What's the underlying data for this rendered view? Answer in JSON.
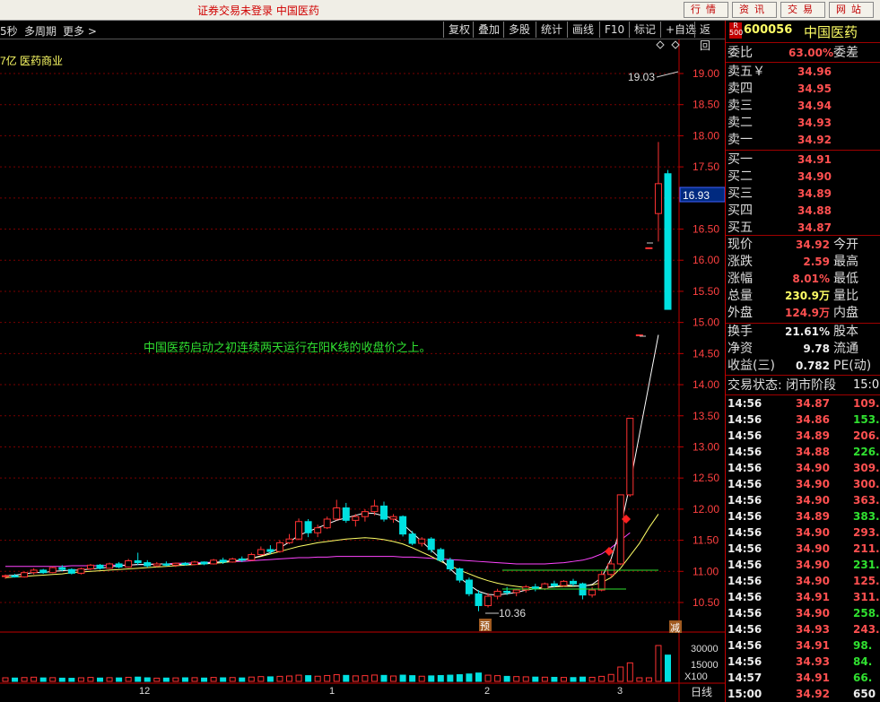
{
  "window": {
    "title": "证券交易未登录  中国医药",
    "top_buttons": [
      "行情",
      "资讯",
      "交易",
      "网站"
    ]
  },
  "toolbar": {
    "left_items": [
      "5秒",
      "多周期",
      "更多 >"
    ],
    "buttons": [
      "复权",
      "叠加",
      "多股",
      "统计",
      "画线",
      "F10",
      "标记",
      "+自选",
      "返回"
    ]
  },
  "chart_header": {
    "info": "7亿  医药商业"
  },
  "annotation": "中国医药启动之初连续两天运行在阳K线的收盘价之上。",
  "markers": {
    "high": "19.03",
    "low": "10.36",
    "yu": "预",
    "jian": "减"
  },
  "current_price_tag": "16.93",
  "volume_labels": {
    "v1": "30000",
    "v2": "15000",
    "scale": "X100"
  },
  "period_label": "日线",
  "x_month_labels": [
    "12",
    "1",
    "2",
    "3"
  ],
  "colors": {
    "up": "#ff3232",
    "down": "#00e0e0",
    "ma5": "#ffffff",
    "ma10": "#ffff66",
    "ma20": "#ff44ff",
    "grid": "#7a0000"
  },
  "chart_data": {
    "type": "candlestick",
    "ylim": [
      10.1,
      19.4
    ],
    "y_ticks": [
      "19.00",
      "18.50",
      "18.00",
      "17.50",
      "17.00",
      "16.50",
      "16.00",
      "15.50",
      "15.00",
      "14.50",
      "14.00",
      "13.50",
      "13.00",
      "12.50",
      "12.00",
      "11.50",
      "11.00",
      "10.50"
    ],
    "candles": [
      [
        10.92,
        10.95,
        10.88,
        10.93
      ],
      [
        10.93,
        10.96,
        10.9,
        10.91
      ],
      [
        10.91,
        11.0,
        10.9,
        10.98
      ],
      [
        10.98,
        11.05,
        10.95,
        11.02
      ],
      [
        11.02,
        11.04,
        10.96,
        10.98
      ],
      [
        10.98,
        11.08,
        10.97,
        11.06
      ],
      [
        11.06,
        11.1,
        11.0,
        11.03
      ],
      [
        11.03,
        11.05,
        10.95,
        10.97
      ],
      [
        10.97,
        11.06,
        10.95,
        11.04
      ],
      [
        11.04,
        11.12,
        11.02,
        11.1
      ],
      [
        11.1,
        11.12,
        11.03,
        11.05
      ],
      [
        11.05,
        11.14,
        11.04,
        11.12
      ],
      [
        11.12,
        11.15,
        11.05,
        11.07
      ],
      [
        11.07,
        11.2,
        11.06,
        11.17
      ],
      [
        11.17,
        11.3,
        11.1,
        11.14
      ],
      [
        11.14,
        11.18,
        11.06,
        11.09
      ],
      [
        11.09,
        11.15,
        11.07,
        11.12
      ],
      [
        11.12,
        11.16,
        11.08,
        11.1
      ],
      [
        11.1,
        11.14,
        11.07,
        11.13
      ],
      [
        11.13,
        11.15,
        11.09,
        11.11
      ],
      [
        11.11,
        11.17,
        11.1,
        11.15
      ],
      [
        11.15,
        11.16,
        11.1,
        11.12
      ],
      [
        11.12,
        11.2,
        11.11,
        11.18
      ],
      [
        11.18,
        11.22,
        11.12,
        11.15
      ],
      [
        11.15,
        11.22,
        11.14,
        11.2
      ],
      [
        11.2,
        11.24,
        11.15,
        11.18
      ],
      [
        11.18,
        11.3,
        11.17,
        11.27
      ],
      [
        11.27,
        11.4,
        11.25,
        11.35
      ],
      [
        11.35,
        11.42,
        11.28,
        11.32
      ],
      [
        11.32,
        11.5,
        11.3,
        11.46
      ],
      [
        11.46,
        11.6,
        11.44,
        11.52
      ],
      [
        11.52,
        11.85,
        11.5,
        11.8
      ],
      [
        11.8,
        11.84,
        11.55,
        11.62
      ],
      [
        11.62,
        11.75,
        11.55,
        11.7
      ],
      [
        11.7,
        11.88,
        11.68,
        11.84
      ],
      [
        11.84,
        12.15,
        11.82,
        12.02
      ],
      [
        12.02,
        12.1,
        11.78,
        11.82
      ],
      [
        11.82,
        11.92,
        11.72,
        11.88
      ],
      [
        11.88,
        12.0,
        11.8,
        11.96
      ],
      [
        11.96,
        12.15,
        11.9,
        12.05
      ],
      [
        12.05,
        12.12,
        11.8,
        11.84
      ],
      [
        11.84,
        11.92,
        11.78,
        11.88
      ],
      [
        11.88,
        11.9,
        11.56,
        11.6
      ],
      [
        11.6,
        11.65,
        11.42,
        11.45
      ],
      [
        11.45,
        11.55,
        11.4,
        11.52
      ],
      [
        11.52,
        11.55,
        11.3,
        11.35
      ],
      [
        11.35,
        11.38,
        11.15,
        11.18
      ],
      [
        11.18,
        11.22,
        11.0,
        11.04
      ],
      [
        11.04,
        11.06,
        10.82,
        10.86
      ],
      [
        10.86,
        10.9,
        10.6,
        10.64
      ],
      [
        10.64,
        10.7,
        10.36,
        10.45
      ],
      [
        10.45,
        10.65,
        10.42,
        10.6
      ],
      [
        10.6,
        10.72,
        10.55,
        10.68
      ],
      [
        10.68,
        10.75,
        10.62,
        10.66
      ],
      [
        10.66,
        10.72,
        10.6,
        10.7
      ],
      [
        10.7,
        10.78,
        10.66,
        10.75
      ],
      [
        10.75,
        10.8,
        10.68,
        10.72
      ],
      [
        10.72,
        10.82,
        10.7,
        10.8
      ],
      [
        10.8,
        10.85,
        10.74,
        10.77
      ],
      [
        10.77,
        10.86,
        10.75,
        10.84
      ],
      [
        10.84,
        10.88,
        10.76,
        10.8
      ],
      [
        10.8,
        10.82,
        10.55,
        10.62
      ],
      [
        10.62,
        10.75,
        10.58,
        10.7
      ],
      [
        10.7,
        11.0,
        10.68,
        10.95
      ],
      [
        10.95,
        11.2,
        10.9,
        11.12
      ],
      [
        11.12,
        12.23,
        11.1,
        12.23
      ],
      [
        12.23,
        13.46,
        12.2,
        13.46
      ],
      [
        14.8,
        14.8,
        14.8,
        14.8
      ],
      [
        16.2,
        16.2,
        16.2,
        16.2
      ],
      [
        16.75,
        17.9,
        16.3,
        17.23
      ],
      [
        17.39,
        17.45,
        15.21,
        15.21
      ]
    ],
    "ma5": [
      10.93,
      10.94,
      10.96,
      10.98,
      10.98,
      11.0,
      11.01,
      11.02,
      11.02,
      11.04,
      11.05,
      11.07,
      11.09,
      11.1,
      11.11,
      11.11,
      11.12,
      11.12,
      11.11,
      11.11,
      11.12,
      11.13,
      11.14,
      11.16,
      11.17,
      11.18,
      11.21,
      11.25,
      11.3,
      11.38,
      11.47,
      11.58,
      11.64,
      11.7,
      11.76,
      11.82,
      11.86,
      11.9,
      11.94,
      11.93,
      11.89,
      11.85,
      11.76,
      11.62,
      11.48,
      11.34,
      11.2,
      11.04,
      10.9,
      10.78,
      10.68,
      10.63,
      10.62,
      10.64,
      10.66,
      10.7,
      10.72,
      10.74,
      10.76,
      10.78,
      10.77,
      10.76,
      10.79,
      10.9,
      11.2,
      11.7,
      12.4,
      13.2,
      14.0,
      14.8
    ],
    "ma10": [
      10.9,
      10.91,
      10.92,
      10.93,
      10.94,
      10.95,
      10.96,
      10.98,
      10.99,
      11.0,
      11.01,
      11.02,
      11.03,
      11.04,
      11.05,
      11.06,
      11.07,
      11.08,
      11.09,
      11.1,
      11.11,
      11.12,
      11.13,
      11.14,
      11.16,
      11.18,
      11.21,
      11.24,
      11.28,
      11.32,
      11.36,
      11.4,
      11.43,
      11.46,
      11.48,
      11.5,
      11.52,
      11.53,
      11.54,
      11.53,
      11.51,
      11.48,
      11.44,
      11.38,
      11.31,
      11.24,
      11.16,
      11.09,
      11.02,
      10.96,
      10.9,
      10.85,
      10.81,
      10.78,
      10.76,
      10.74,
      10.74,
      10.74,
      10.75,
      10.76,
      10.76,
      10.77,
      10.78,
      10.82,
      10.9,
      11.05,
      11.25,
      11.45,
      11.7,
      11.92
    ],
    "ma20": [
      11.08,
      11.08,
      11.08,
      11.08,
      11.08,
      11.08,
      11.08,
      11.09,
      11.09,
      11.09,
      11.09,
      11.1,
      11.1,
      11.1,
      11.11,
      11.11,
      11.12,
      11.12,
      11.13,
      11.13,
      11.14,
      11.14,
      11.15,
      11.15,
      11.16,
      11.16,
      11.17,
      11.18,
      11.19,
      11.2,
      11.21,
      11.22,
      11.22,
      11.23,
      11.23,
      11.24,
      11.24,
      11.24,
      11.24,
      11.24,
      11.24,
      11.24,
      11.23,
      11.23,
      11.22,
      11.21,
      11.2,
      11.19,
      11.18,
      11.17,
      11.16,
      11.15,
      11.14,
      11.13,
      11.12,
      11.12,
      11.12,
      11.12,
      11.13,
      11.14,
      11.16,
      11.18,
      11.22,
      11.28,
      11.38,
      11.5,
      11.62
    ],
    "volume": [
      3000,
      2800,
      3200,
      3500,
      2900,
      3100,
      2700,
      2600,
      3000,
      3300,
      2800,
      3100,
      2900,
      3400,
      3600,
      3000,
      2700,
      2800,
      2900,
      3000,
      3100,
      2800,
      3300,
      3000,
      3200,
      2900,
      3600,
      4000,
      3800,
      4200,
      4500,
      5200,
      4800,
      4300,
      4900,
      5600,
      5000,
      4600,
      4800,
      5300,
      5000,
      4500,
      5200,
      4800,
      4300,
      4600,
      4900,
      5200,
      5600,
      6200,
      7000,
      5200,
      4800,
      4200,
      4000,
      3800,
      3600,
      3500,
      3400,
      3300,
      3200,
      3600,
      3400,
      4200,
      5800,
      12000,
      15500,
      3000,
      3000,
      30000,
      22000
    ],
    "volume_ylim": [
      0,
      36000
    ]
  },
  "quote": {
    "code_tag_top": "R",
    "code_tag_bottom": "500",
    "code": "600056",
    "name": "中国医药",
    "weibi_label": "委比",
    "weibi_value": "63.00%",
    "weicha_label": "委差",
    "asks": [
      {
        "label": "卖五￥",
        "price": "34.96"
      },
      {
        "label": "卖四",
        "price": "34.95"
      },
      {
        "label": "卖三",
        "price": "34.94"
      },
      {
        "label": "卖二",
        "price": "34.93"
      },
      {
        "label": "卖一",
        "price": "34.92"
      }
    ],
    "bids": [
      {
        "label": "买一",
        "price": "34.91"
      },
      {
        "label": "买二",
        "price": "34.90"
      },
      {
        "label": "买三",
        "price": "34.89"
      },
      {
        "label": "买四",
        "price": "34.88"
      },
      {
        "label": "买五",
        "price": "34.87"
      }
    ],
    "stats": [
      {
        "label": "现价",
        "value": "34.92",
        "right": "今开",
        "color": "#ff5050"
      },
      {
        "label": "涨跌",
        "value": "2.59",
        "right": "最高",
        "color": "#ff5050"
      },
      {
        "label": "涨幅",
        "value": "8.01%",
        "right": "最低",
        "color": "#ff5050"
      },
      {
        "label": "总量",
        "value": "230.9万",
        "right": "量比",
        "color": "#ffff66"
      },
      {
        "label": "外盘",
        "value": "124.9万",
        "right": "内盘",
        "color": "#ff5050"
      },
      {
        "label": "换手",
        "value": "21.61%",
        "right": "股本",
        "color": "#eeeeee"
      },
      {
        "label": "净资",
        "value": "9.78",
        "right": "流通",
        "color": "#eeeeee"
      },
      {
        "label": "收益(三)",
        "value": "0.782",
        "right": "PE(动)",
        "color": "#eeeeee"
      }
    ],
    "trade_status": "交易状态: 闭市阶段",
    "trade_status_time": "15:00",
    "ticks": [
      {
        "t": "14:56",
        "p": "34.87",
        "v": "109.",
        "c": "#ff5050"
      },
      {
        "t": "14:56",
        "p": "34.86",
        "v": "153.",
        "c": "#30e030"
      },
      {
        "t": "14:56",
        "p": "34.89",
        "v": "206.",
        "c": "#ff5050"
      },
      {
        "t": "14:56",
        "p": "34.88",
        "v": "226.",
        "c": "#30e030"
      },
      {
        "t": "14:56",
        "p": "34.90",
        "v": "309.",
        "c": "#ff5050"
      },
      {
        "t": "14:56",
        "p": "34.90",
        "v": "300.",
        "c": "#ff5050"
      },
      {
        "t": "14:56",
        "p": "34.90",
        "v": "363.",
        "c": "#ff5050"
      },
      {
        "t": "14:56",
        "p": "34.89",
        "v": "383.",
        "c": "#30e030"
      },
      {
        "t": "14:56",
        "p": "34.90",
        "v": "293.",
        "c": "#ff5050"
      },
      {
        "t": "14:56",
        "p": "34.90",
        "v": "211.",
        "c": "#ff5050"
      },
      {
        "t": "14:56",
        "p": "34.90",
        "v": "231.",
        "c": "#30e030"
      },
      {
        "t": "14:56",
        "p": "34.90",
        "v": "125.",
        "c": "#ff5050"
      },
      {
        "t": "14:56",
        "p": "34.91",
        "v": "311.",
        "c": "#ff5050"
      },
      {
        "t": "14:56",
        "p": "34.90",
        "v": "258.",
        "c": "#30e030"
      },
      {
        "t": "14:56",
        "p": "34.93",
        "v": "243.",
        "c": "#ff5050"
      },
      {
        "t": "14:56",
        "p": "34.91",
        "v": "98.",
        "c": "#30e030"
      },
      {
        "t": "14:56",
        "p": "34.93",
        "v": "84.",
        "c": "#30e030"
      },
      {
        "t": "14:57",
        "p": "34.91",
        "v": "66.",
        "c": "#30e030"
      },
      {
        "t": "15:00",
        "p": "34.92",
        "v": "650",
        "c": "#eeeeee"
      }
    ]
  }
}
